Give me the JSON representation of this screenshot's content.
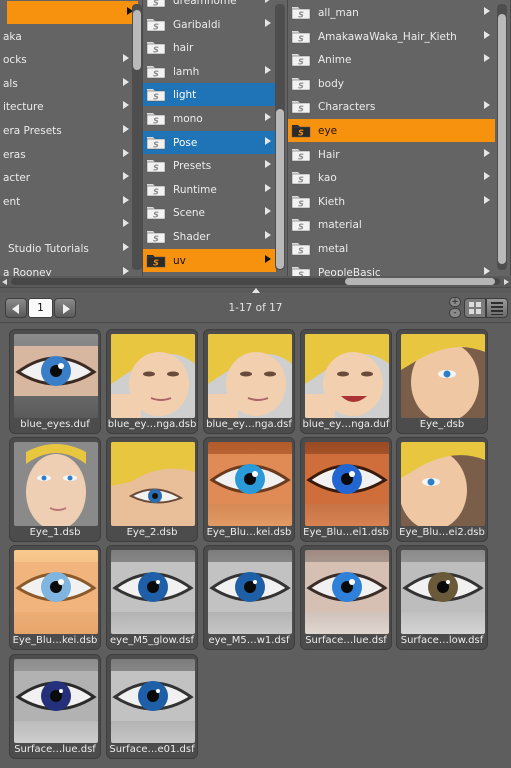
{
  "colors": {
    "selected_blue": "#1f73b7",
    "selected_orange": "#f7920f",
    "panel_bg": "#646464"
  },
  "browser": {
    "column1": {
      "items": [
        {
          "label": "",
          "has_arrow": true,
          "state": "orange"
        },
        {
          "label": "aka",
          "has_arrow": false,
          "state": ""
        },
        {
          "label": "ocks",
          "has_arrow": true,
          "state": ""
        },
        {
          "label": "als",
          "has_arrow": true,
          "state": ""
        },
        {
          "label": "itecture",
          "has_arrow": true,
          "state": ""
        },
        {
          "label": "era Presets",
          "has_arrow": true,
          "state": ""
        },
        {
          "label": "eras",
          "has_arrow": true,
          "state": ""
        },
        {
          "label": "acter",
          "has_arrow": true,
          "state": ""
        },
        {
          "label": "ent",
          "has_arrow": true,
          "state": ""
        },
        {
          "label": "",
          "has_arrow": true,
          "state": ""
        },
        {
          "label": "Studio Tutorials",
          "has_arrow": true,
          "state": ""
        },
        {
          "label": "a Rooney",
          "has_arrow": true,
          "state": ""
        }
      ]
    },
    "column2": {
      "items": [
        {
          "label": "dreamhome",
          "has_arrow": true,
          "state": ""
        },
        {
          "label": "Garibaldi",
          "has_arrow": true,
          "state": ""
        },
        {
          "label": "hair",
          "has_arrow": false,
          "state": ""
        },
        {
          "label": "lamh",
          "has_arrow": true,
          "state": ""
        },
        {
          "label": "light",
          "has_arrow": false,
          "state": "blue"
        },
        {
          "label": "mono",
          "has_arrow": true,
          "state": ""
        },
        {
          "label": "Pose",
          "has_arrow": true,
          "state": "blue"
        },
        {
          "label": "Presets",
          "has_arrow": true,
          "state": ""
        },
        {
          "label": "Runtime",
          "has_arrow": true,
          "state": ""
        },
        {
          "label": "Scene",
          "has_arrow": true,
          "state": ""
        },
        {
          "label": "Shader",
          "has_arrow": true,
          "state": ""
        },
        {
          "label": "uv",
          "has_arrow": true,
          "state": "orange"
        }
      ]
    },
    "column3": {
      "items": [
        {
          "label": "all_man",
          "has_arrow": true,
          "state": ""
        },
        {
          "label": "AmakawaWaka_Hair_Kieth",
          "has_arrow": true,
          "state": ""
        },
        {
          "label": "Anime",
          "has_arrow": true,
          "state": ""
        },
        {
          "label": "body",
          "has_arrow": false,
          "state": ""
        },
        {
          "label": "Characters",
          "has_arrow": true,
          "state": ""
        },
        {
          "label": "eye",
          "has_arrow": false,
          "state": "orange"
        },
        {
          "label": "Hair",
          "has_arrow": true,
          "state": ""
        },
        {
          "label": "kao",
          "has_arrow": true,
          "state": ""
        },
        {
          "label": "Kieth",
          "has_arrow": true,
          "state": ""
        },
        {
          "label": "material",
          "has_arrow": false,
          "state": ""
        },
        {
          "label": "metal",
          "has_arrow": false,
          "state": ""
        },
        {
          "label": "PeopleBasic",
          "has_arrow": true,
          "state": ""
        }
      ]
    }
  },
  "toolbar": {
    "page_number": "1",
    "range_text": "1-17 of 17",
    "zoom_plus": "+",
    "zoom_minus": "-"
  },
  "files": [
    {
      "label": "blue_eyes.duf",
      "kind": "eye-blue"
    },
    {
      "label": "blue_ey…nga.dsb",
      "kind": "face-blonde"
    },
    {
      "label": "blue_ey…nga.dsf",
      "kind": "face-blonde"
    },
    {
      "label": "blue_ey…nga.duf",
      "kind": "face-smile"
    },
    {
      "label": "Eye_.dsb",
      "kind": "face-side"
    },
    {
      "label": "Eye_1.dsb",
      "kind": "face-front"
    },
    {
      "label": "Eye_2.dsb",
      "kind": "face-close"
    },
    {
      "label": "Eye_Blu…kei.dsb",
      "kind": "eye-orange"
    },
    {
      "label": "Eye_Blu…ei1.dsb",
      "kind": "eye-orange-dark"
    },
    {
      "label": "Eye_Blu…ei2.dsb",
      "kind": "face-profile"
    },
    {
      "label": "Eye_Blu…kei.dsb",
      "kind": "eye-light"
    },
    {
      "label": "eye_M5_glow.dsf",
      "kind": "eye-grey"
    },
    {
      "label": "eye_M5…w1.dsf",
      "kind": "eye-grey"
    },
    {
      "label": "Surface…lue.dsf",
      "kind": "eye-sparkle"
    },
    {
      "label": "Surface…low.dsf",
      "kind": "eye-hazel"
    },
    {
      "label": "Surface…lue.dsf",
      "kind": "eye-darkblue"
    },
    {
      "label": "Surface…e01.dsf",
      "kind": "eye-grey"
    }
  ]
}
